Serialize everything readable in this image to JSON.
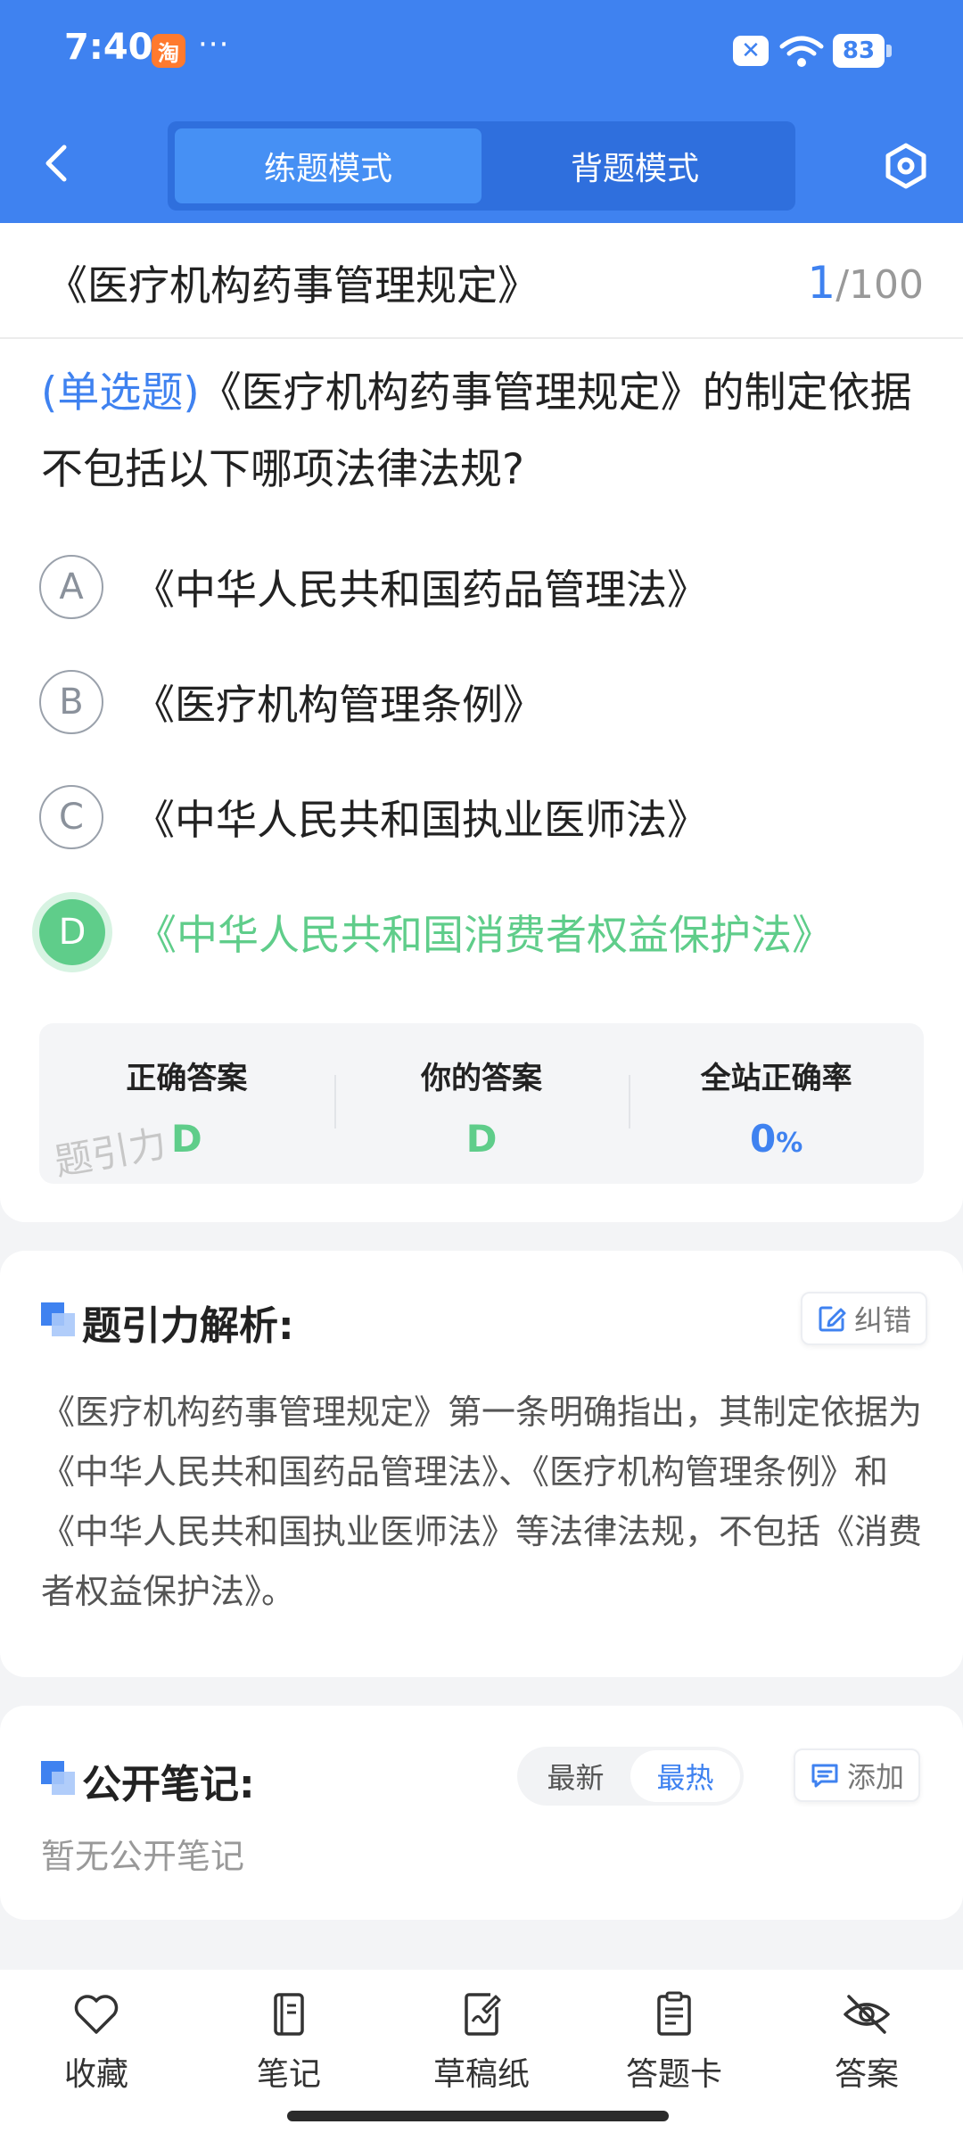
{
  "status_bar": {
    "time": "7:40",
    "app_badge": "淘",
    "more": "···",
    "notification": "✕",
    "battery": "83"
  },
  "header": {
    "tabs": [
      {
        "label": "练题模式",
        "active": true
      },
      {
        "label": "背题模式",
        "active": false
      }
    ]
  },
  "title_row": {
    "title": "《医疗机构药事管理规定》",
    "current": "1",
    "total": "/100"
  },
  "question": {
    "type": "(单选题)",
    "text": "《医疗机构药事管理规定》的制定依据不包括以下哪项法律法规?",
    "options": [
      {
        "letter": "A",
        "text": "《中华人民共和国药品管理法》"
      },
      {
        "letter": "B",
        "text": "《医疗机构管理条例》"
      },
      {
        "letter": "C",
        "text": "《中华人民共和国执业医师法》"
      },
      {
        "letter": "D",
        "text": "《中华人民共和国消费者权益保护法》",
        "correct": true
      }
    ]
  },
  "answer_summary": {
    "correct_label": "正确答案",
    "correct_value": "D",
    "yours_label": "你的答案",
    "yours_value": "D",
    "rate_label": "全站正确率",
    "rate_value": "0",
    "rate_unit": "%",
    "watermark": "题引力"
  },
  "analysis": {
    "title": "题引力解析:",
    "report_label": "纠错",
    "text": "《医疗机构药事管理规定》第一条明确指出，其制定依据为《中华人民共和国药品管理法》、《医疗机构管理条例》和《中华人民共和国执业医师法》等法律法规，不包括《消费者权益保护法》。"
  },
  "notes": {
    "title": "公开笔记:",
    "sort_options": [
      "最新",
      "最热"
    ],
    "sort_active": "最热",
    "add_label": "添加",
    "empty_text": "暂无公开笔记"
  },
  "bottom_nav": [
    {
      "label": "收藏",
      "icon": "heart-icon"
    },
    {
      "label": "笔记",
      "icon": "notebook-icon"
    },
    {
      "label": "草稿纸",
      "icon": "draft-icon"
    },
    {
      "label": "答题卡",
      "icon": "answer-sheet-icon"
    },
    {
      "label": "答案",
      "icon": "eye-off-icon"
    }
  ],
  "colors": {
    "primary": "#3f82f0",
    "correct": "#5fcd8a"
  }
}
